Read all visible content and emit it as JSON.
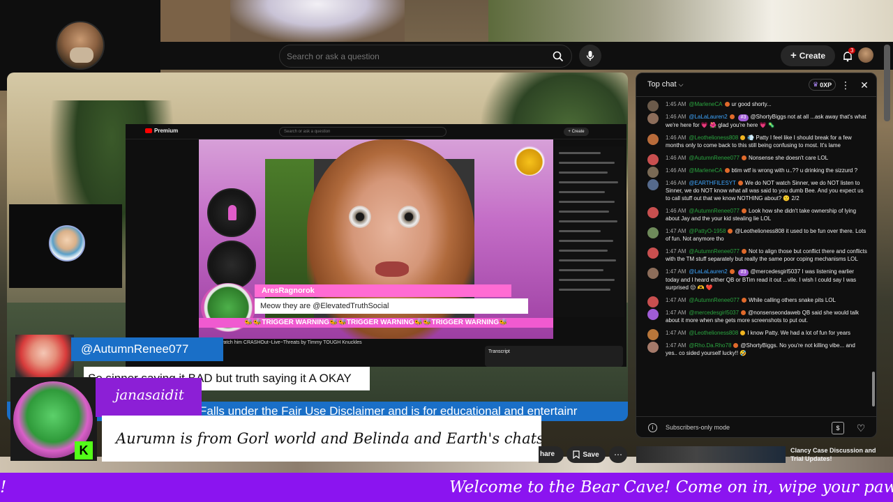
{
  "header": {
    "search_placeholder": "Search or ask a question",
    "create_label": "Create",
    "notification_count": "3"
  },
  "player": {
    "inner_logo": "Premium",
    "inner_search_placeholder": "Search or ask a question",
    "inner_create": "+ Create",
    "alert_username": "AresRagnorok",
    "alert_message": "Meow they are @ElevatedTruthSocial",
    "trigger_banner": "🐝🐝TRIGGER WARNING🐝🐝TRIGGER WARNING🐝🐝TRIGGER WARNING🐝",
    "inner_video_title": "DATOR &watch him CRASHOut~Live~Threats by Timmy TOUGH Knuckles",
    "transcript_label": "Transcript",
    "caption_username": "@AutumnRenee077",
    "caption_text": "So sinner saying it BAD but truth saying it A OKAY",
    "disclaimer": "Falls under the Fair Use Disclaimer and is for educational and entertainr"
  },
  "highlight": {
    "username": "janasaidit",
    "message": "Aurumn is from Gorl world and Belinda and Earth's chats",
    "k_badge": "K"
  },
  "actions": {
    "share_label": "hare",
    "save_label": "Save"
  },
  "recommendation": {
    "title": "Clancy Case Discussion and Trial Updates!"
  },
  "chat": {
    "mode_label": "Top chat",
    "xp_label": "0XP",
    "footer_text": "Subscribers-only mode",
    "messages": [
      {
        "time": "1:45 AM",
        "author": "@MarleneCA",
        "text": "ur good shorty..."
      },
      {
        "time": "1:46 AM",
        "author": "@LaLaLauren2",
        "tier": "#3",
        "text": "@ShortyBiggs not at all ...ask away that's what we're here for 💗 🌺 glad you're here 💗 🦠"
      },
      {
        "time": "1:46 AM",
        "author": "@Leothelioness808",
        "text": "💨 Patty I feel like I should break for a few months only to come back to this still being confusing to most. It's lame"
      },
      {
        "time": "1:46 AM",
        "author": "@AutumnRenee077",
        "text": "Nonsense she doesn't care LOL"
      },
      {
        "time": "1:46 AM",
        "author": "@MarleneCA",
        "text": "btim wtf is wrong with u..?? u drinking the sizzurd ?"
      },
      {
        "time": "1:46 AM",
        "author": "@EARTHFILESYT",
        "text": "We do NOT watch Sinner, we do NOT listen to Sinner, we do NOT know what all was said to you dumb Bee. And you expect us to call stuff out that we know NOTHING about? 🙁 2/2"
      },
      {
        "time": "1:46 AM",
        "author": "@AutumnRenee077",
        "text": "Look how she didn't take ownership of lying about Jay and the your kid stealing lie LOL"
      },
      {
        "time": "1:47 AM",
        "author": "@PattyO-1958",
        "text": "@Leothelioness808 it used to be fun over there. Lots of fun. Not anymore tho"
      },
      {
        "time": "1:47 AM",
        "author": "@AutumnRenee077",
        "text": "Not to align those but conflict there and conflicts with the TM stuff separately but really the same poor coping mechanisms LOL"
      },
      {
        "time": "1:47 AM",
        "author": "@LaLaLauren2",
        "tier": "#3",
        "text": "@mercedesgirl5037 I was listening earlier today and I heard either QB or BTim read it out ...vile. I wish I could say I was surprised 😒 🫶 ❤️"
      },
      {
        "time": "1:47 AM",
        "author": "@AutumnRenee077",
        "text": "While calling others snake pits LOL"
      },
      {
        "time": "1:47 AM",
        "author": "@mercedesgirl5037",
        "text": "@nonsenseondaweb QB said she would talk about it more when she gets more screenshots to put out."
      },
      {
        "time": "1:47 AM",
        "author": "@Leothelioness808",
        "text": "I know Patty. We had a lot of fun for years"
      },
      {
        "time": "1:47 AM",
        "author": "@Rho.Da.Rho78",
        "text": "@ShortyBiggs. No you're not killing vibe... and yes.. co sided yourself lucky!! 🤣"
      }
    ]
  },
  "ticker": {
    "left_fragment": "!",
    "main_text": "Welcome to the Bear Cave! Come on in, wipe your paws and"
  },
  "colors": {
    "ticker_purple": "#8b14f0",
    "alert_pink": "#ff6bd3",
    "chat_author_green": "#2ba640",
    "caption_blue": "#1a6fc7"
  }
}
